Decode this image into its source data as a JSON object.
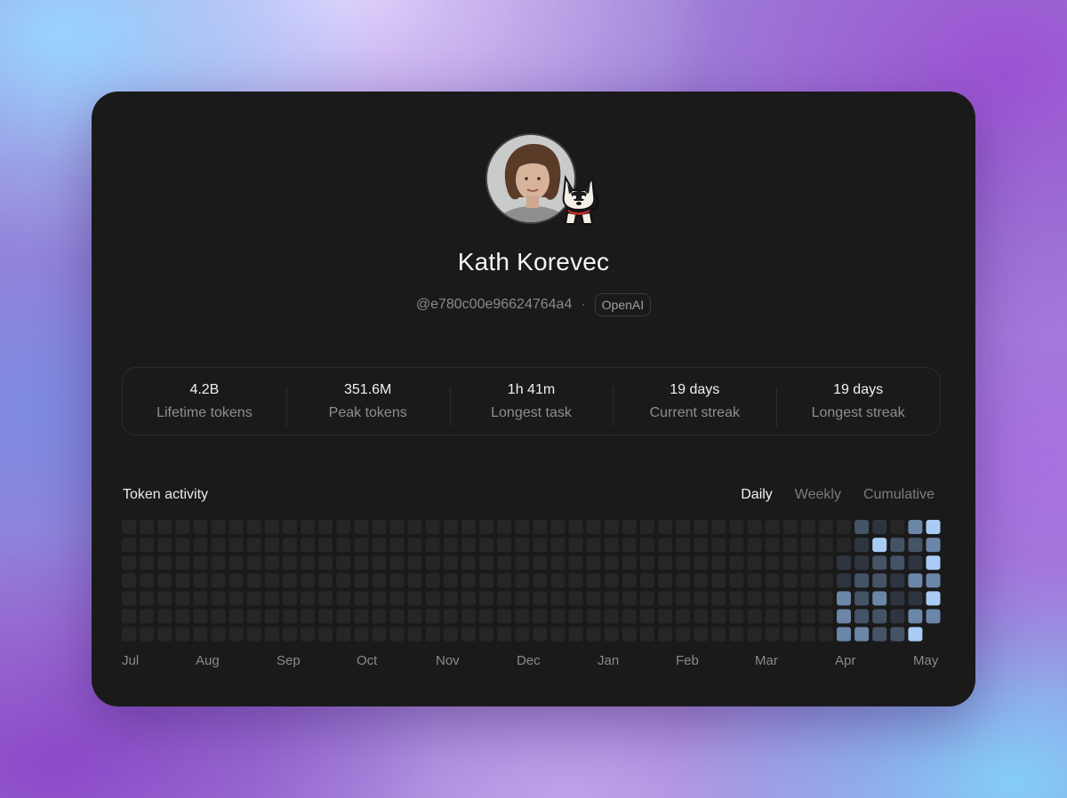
{
  "profile": {
    "name": "Kath Korevec",
    "handle": "@e780c00e96624764a4",
    "separator": "·",
    "org_badge": "OpenAI"
  },
  "stats": [
    {
      "value": "4.2B",
      "label": "Lifetime tokens"
    },
    {
      "value": "351.6M",
      "label": "Peak tokens"
    },
    {
      "value": "1h 41m",
      "label": "Longest task"
    },
    {
      "value": "19 days",
      "label": "Current streak"
    },
    {
      "value": "19 days",
      "label": "Longest streak"
    }
  ],
  "activity": {
    "title": "Token activity",
    "views": [
      "Daily",
      "Weekly",
      "Cumulative"
    ],
    "active_view": "Daily",
    "months": [
      "Jul",
      "Aug",
      "Sep",
      "Oct",
      "Nov",
      "Dec",
      "Jan",
      "Feb",
      "Mar",
      "Apr",
      "May"
    ],
    "rows": 7,
    "columns": 46,
    "level_colors": [
      "#262626",
      "#2f3540",
      "#455366",
      "#6b86a8",
      "#a8ccf5"
    ],
    "active_columns": [
      {
        "column": 40,
        "levels": [
          0,
          0,
          1,
          1,
          3,
          3,
          3
        ]
      },
      {
        "column": 41,
        "levels": [
          2,
          1,
          1,
          2,
          2,
          2,
          3
        ]
      },
      {
        "column": 42,
        "levels": [
          1,
          4,
          2,
          2,
          3,
          2,
          2
        ]
      },
      {
        "column": 43,
        "levels": [
          0,
          2,
          2,
          1,
          1,
          1,
          2
        ]
      },
      {
        "column": 44,
        "levels": [
          3,
          2,
          1,
          3,
          1,
          3,
          4
        ]
      },
      {
        "column": 45,
        "levels": [
          4,
          3,
          4,
          3,
          4,
          3,
          null
        ]
      }
    ]
  }
}
